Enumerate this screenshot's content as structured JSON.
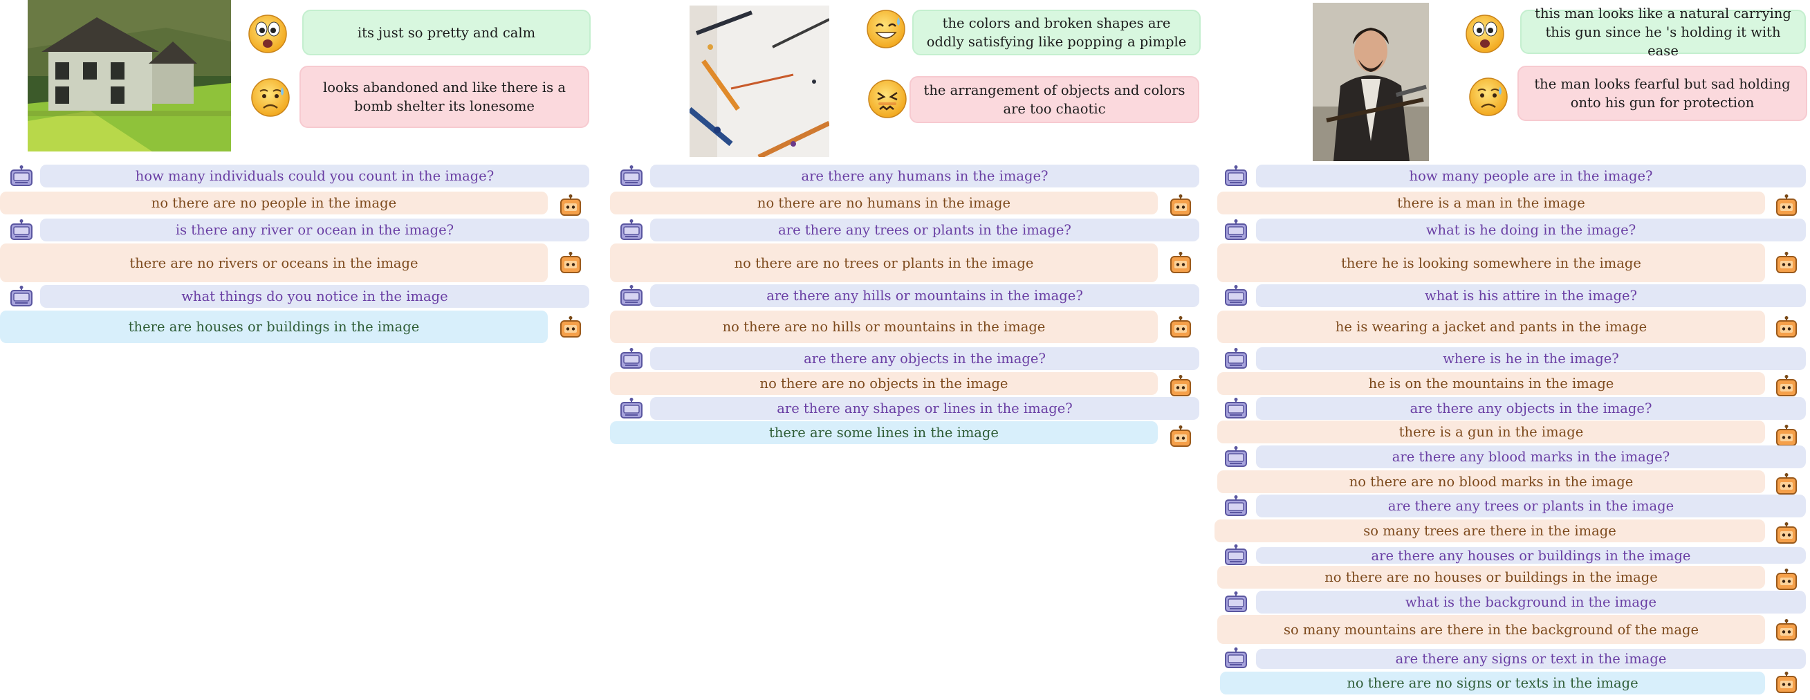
{
  "panels": [
    {
      "painting": "painting-house",
      "reactions": [
        {
          "sentiment": "positive",
          "emoji": "awestruck-face-icon",
          "text": "its just so pretty and calm"
        },
        {
          "sentiment": "negative",
          "emoji": "worried-sweat-face-icon",
          "text": "looks abandoned and like there is a bomb shelter  its lonesome"
        }
      ],
      "dialogue": [
        {
          "role": "question",
          "text": "how many individuals could you count in the image?"
        },
        {
          "role": "answer",
          "text": "no there are no people in the image"
        },
        {
          "role": "question",
          "text": "is there any river or ocean in the image?"
        },
        {
          "role": "answer",
          "text": "there  are no rivers or oceans in the image"
        },
        {
          "role": "question",
          "text": "what things do you notice in the image"
        },
        {
          "role": "final",
          "text": "there  are houses or buildings in the image"
        }
      ]
    },
    {
      "painting": "painting-abstract",
      "reactions": [
        {
          "sentiment": "positive",
          "emoji": "grinning-sweat-face-icon",
          "text": "the colors and broken shapes are oddly satisfying like popping a pimple"
        },
        {
          "sentiment": "negative",
          "emoji": "confounded-face-icon",
          "text": "the  arrangement of objects and colors are too chaotic"
        }
      ],
      "dialogue": [
        {
          "role": "question",
          "text": "are there any humans in the image?"
        },
        {
          "role": "answer",
          "text": "no there are no humans in the image"
        },
        {
          "role": "question",
          "text": "are there any trees or plants in the image?"
        },
        {
          "role": "answer",
          "text": "no there are no trees or plants in the image"
        },
        {
          "role": "question",
          "text": "are there any hills or mountains in the image?"
        },
        {
          "role": "answer",
          "text": "no there are no hills or mountains in the image"
        },
        {
          "role": "question",
          "text": "are there any objects in the image?"
        },
        {
          "role": "answer",
          "text": "no there are no objects in the image"
        },
        {
          "role": "question",
          "text": "are there any shapes or lines in the image?"
        },
        {
          "role": "final",
          "text": "there  are some lines in the image"
        }
      ]
    },
    {
      "painting": "painting-portrait",
      "reactions": [
        {
          "sentiment": "positive",
          "emoji": "awestruck-face-icon",
          "text": "this man looks like a natural carrying this gun since he 's holding it with ease"
        },
        {
          "sentiment": "negative",
          "emoji": "worried-sweat-face-icon",
          "text": "the man looks fearful but sad holding onto his gun for protection"
        }
      ],
      "dialogue": [
        {
          "role": "question",
          "text": "how many people are in the image?"
        },
        {
          "role": "answer",
          "text": "there  is  a  man  in the image"
        },
        {
          "role": "question",
          "text": "what is he doing in the image?"
        },
        {
          "role": "answer",
          "text": "there  he is looking somewhere in the image"
        },
        {
          "role": "question",
          "text": "what is his attire in the image?"
        },
        {
          "role": "answer",
          "text": "he is wearing  a  jacket and pants in the image"
        },
        {
          "role": "question",
          "text": "where is he in the image?"
        },
        {
          "role": "answer",
          "text": "he is on the mountains in the  image"
        },
        {
          "role": "question",
          "text": "are there any objects in the image?"
        },
        {
          "role": "answer",
          "text": "there  is  a  gun in the image"
        },
        {
          "role": "question",
          "text": "are there any blood marks in the image?"
        },
        {
          "role": "answer",
          "text": "no there are no blood marks in the image"
        },
        {
          "role": "question",
          "text": "are there any trees or plants in the image"
        },
        {
          "role": "answer",
          "text": "so many trees are there in the image"
        },
        {
          "role": "question",
          "text": "are there any houses or buildings in the image"
        },
        {
          "role": "answer",
          "text": "no there are no houses or buildings in the image"
        },
        {
          "role": "question",
          "text": "what is the background in the image"
        },
        {
          "role": "answer",
          "text": "so many mountains are there in the background of the mage"
        },
        {
          "role": "question",
          "text": "are there any signs or text in the image"
        },
        {
          "role": "final",
          "text": "no there are no signs or texts in the image"
        }
      ]
    }
  ],
  "colors": {
    "question_bg": "#e2e7f6",
    "question_text": "#6a3fa4",
    "answer_bg": "#fbe9de",
    "answer_text": "#7d4a1d",
    "final_bg": "#d8effb",
    "final_text": "#2f5d37",
    "positive_bg": "#d8f7df",
    "negative_bg": "#fbd9dd",
    "questioner_robot": "#8f8ad0",
    "answerer_robot": "#f5a04a"
  },
  "icons": {
    "questioner": "questioner-robot-icon",
    "answerer": "answerer-robot-icon"
  }
}
